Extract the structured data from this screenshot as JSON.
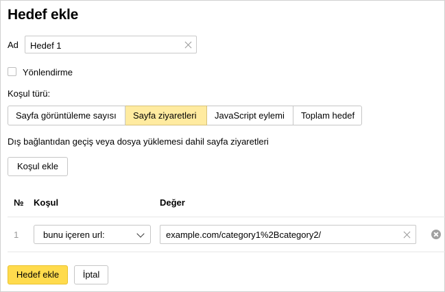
{
  "dialog": {
    "title": "Hedef ekle"
  },
  "name_field": {
    "label": "Ad",
    "value": "Hedef 1"
  },
  "redirect_checkbox": {
    "label": "Yönlendirme",
    "checked": false
  },
  "condition_type": {
    "label": "Koşul türü:",
    "tabs": [
      {
        "label": "Sayfa görüntüleme sayısı",
        "active": false
      },
      {
        "label": "Sayfa ziyaretleri",
        "active": true
      },
      {
        "label": "JavaScript eylemi",
        "active": false
      },
      {
        "label": "Toplam hedef",
        "active": false
      }
    ],
    "description": "Dış bağlantıdan geçiş veya dosya yüklemesi dahil sayfa ziyaretleri"
  },
  "add_condition_label": "Koşul ekle",
  "table": {
    "headers": {
      "number": "№",
      "condition": "Koşul",
      "value": "Değer"
    },
    "rows": [
      {
        "number": "1",
        "condition": "bunu içeren url:",
        "value": "example.com/category1%2Bcategory2/"
      }
    ]
  },
  "footer": {
    "submit_label": "Hedef ekle",
    "cancel_label": "İptal"
  },
  "colors": {
    "active_tab": "#ffeba0",
    "primary_button": "#ffdb4d"
  }
}
